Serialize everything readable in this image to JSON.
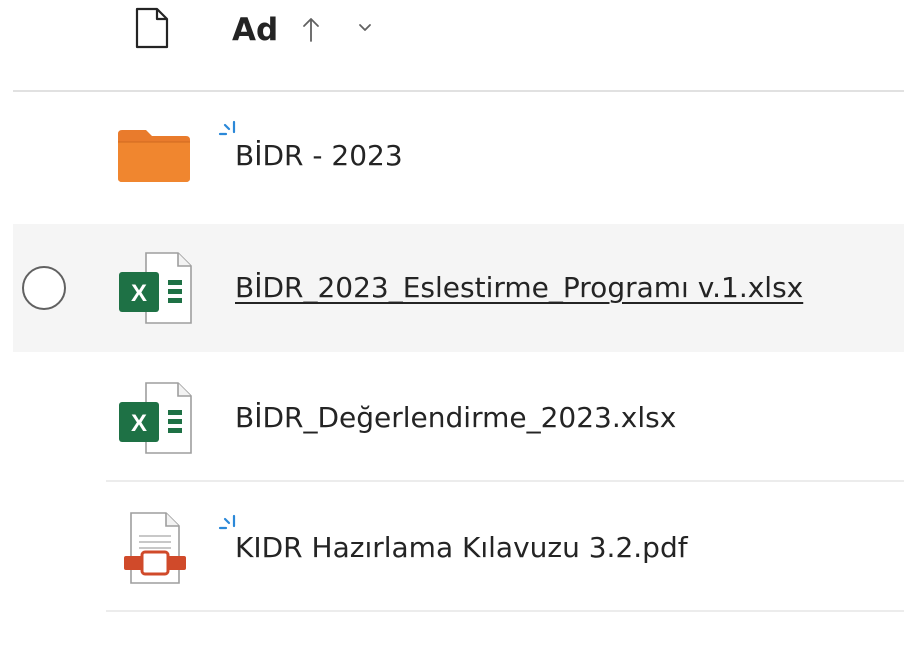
{
  "header": {
    "column_name": "Ad",
    "doc_icon": "document-icon",
    "sort_icon": "arrow-up-icon",
    "menu_icon": "chevron-down-icon"
  },
  "colors": {
    "folder": "#e97b2c",
    "excel": "#1e7145",
    "pdf": "#d04a2a",
    "new_badge": "#2b88d8",
    "hover_row": "#f5f5f5"
  },
  "files": [
    {
      "name": "BİDR - 2023",
      "type": "folder",
      "icon": "folder-icon",
      "new": true
    },
    {
      "name": "BİDR_2023_Eslestirme_Programı v.1.xlsx",
      "type": "excel",
      "icon": "excel-file-icon",
      "new": false,
      "hovered": true
    },
    {
      "name": "BİDR_Değerlendirme_2023.xlsx",
      "type": "excel",
      "icon": "excel-file-icon",
      "new": false
    },
    {
      "name": "KIDR Hazırlama Kılavuzu 3.2.pdf",
      "type": "pdf",
      "icon": "pdf-file-icon",
      "new": true
    }
  ]
}
